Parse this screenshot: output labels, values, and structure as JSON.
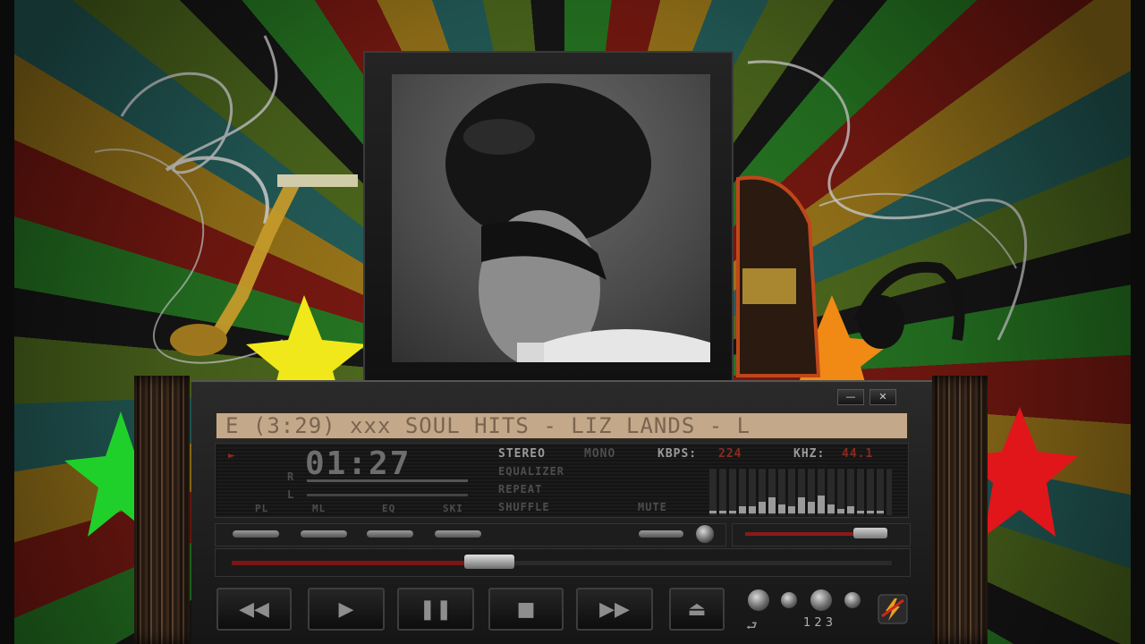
{
  "player": {
    "marquee": "E (3:29) xxx SOUL HITS  -  LIZ LANDS - L",
    "time": "01:27",
    "channel_stereo": "STEREO",
    "channel_mono": "MONO",
    "kbps_label": "KBPS:",
    "kbps_value": "224",
    "khz_label": "KHZ:",
    "khz_value": "44.1",
    "status_items": [
      "EQUALIZER",
      "REPEAT",
      "SHUFFLE"
    ],
    "mute": "MUTE",
    "toggles": [
      "PL",
      "ML",
      "EQ",
      "SKI"
    ],
    "balance_r": "R",
    "balance_l": "L",
    "counter_label": "1 2 3",
    "progress": 0.39,
    "volume": 0.85,
    "eq_levels": [
      0.05,
      0.05,
      0.05,
      0.15,
      0.15,
      0.25,
      0.35,
      0.2,
      0.15,
      0.35,
      0.25,
      0.4,
      0.2,
      0.1,
      0.15,
      0.05,
      0.05,
      0.05
    ],
    "window_buttons": {
      "minimize": "—",
      "close": "✕"
    },
    "transport": {
      "prev": "◀◀",
      "play": "▶",
      "pause": "❚❚",
      "stop": "■",
      "next": "▶▶",
      "eject": "⏏"
    },
    "icons": {
      "prev": "previous-icon",
      "play": "play-icon",
      "pause": "pause-icon",
      "stop": "stop-icon",
      "next": "next-icon",
      "eject": "eject-icon",
      "logo": "lightning-logo-icon"
    }
  },
  "colors": {
    "lcd_amber": "#c3a98a",
    "progress_red": "#8a1a1a",
    "active_value": "#8a2a20"
  }
}
